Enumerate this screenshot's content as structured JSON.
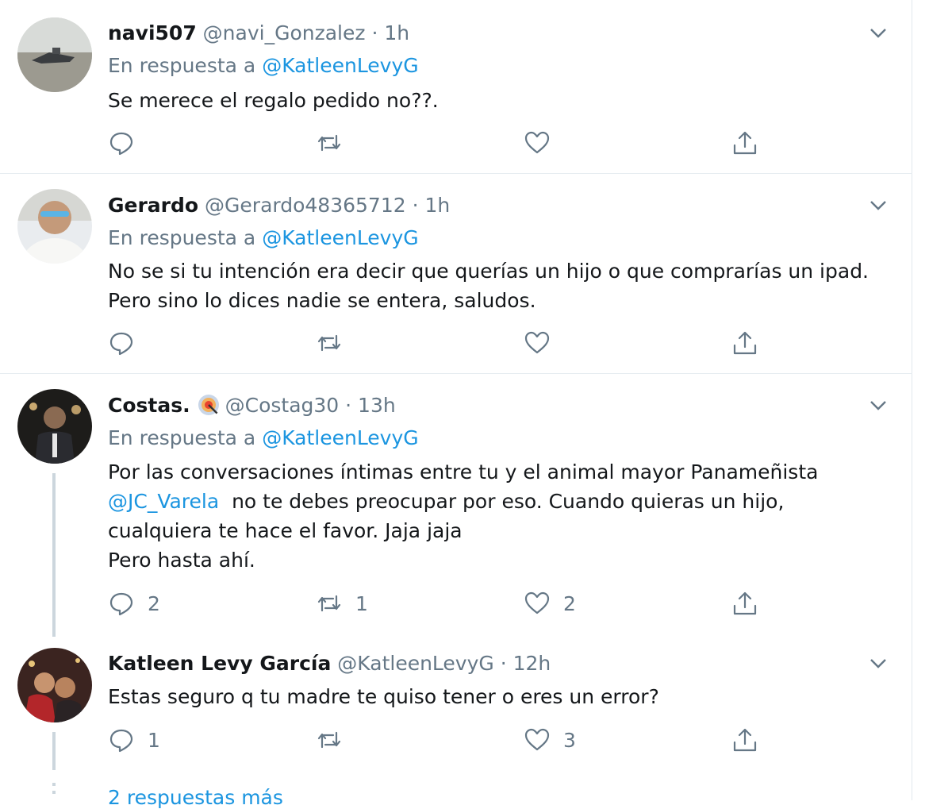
{
  "tweets": [
    {
      "name": "navi507",
      "handle": "@navi_Gonzalez",
      "time": "· 1h",
      "reply_prefix": "En respuesta a",
      "reply_to": "@KatleenLevyG",
      "body": "Se merece el regalo pedido no??.",
      "counts": {
        "reply": "",
        "retweet": "",
        "like": ""
      }
    },
    {
      "name": "Gerardo",
      "handle": "@Gerardo48365712",
      "time": "· 1h",
      "reply_prefix": "En respuesta a",
      "reply_to": "@KatleenLevyG",
      "body_lines": [
        "No se si tu intención era decir que querías un hijo o que comprarías un ipad.",
        "Pero sino lo dices nadie se entera, saludos."
      ],
      "counts": {
        "reply": "",
        "retweet": "",
        "like": ""
      }
    },
    {
      "name": "Costas.",
      "handle": "@Costag30",
      "time": "· 13h",
      "reply_prefix": "En respuesta a",
      "reply_to": "@KatleenLevyG",
      "body_line1": "Por las conversaciones íntimas entre tu y el animal mayor Panameñista",
      "mention": "@JC_Varela",
      "body_line2_rest": "  no te debes preocupar por eso. Cuando quieras un hijo,",
      "body_line3": "cualquiera te hace el favor. Jaja jaja",
      "body_line4": "Pero hasta ahí.",
      "counts": {
        "reply": "2",
        "retweet": "1",
        "like": "2"
      }
    },
    {
      "name": "Katleen Levy García",
      "handle": "@KatleenLevyG",
      "time": "· 12h",
      "body": "Estas seguro q tu madre te quiso tener o eres un error?",
      "counts": {
        "reply": "1",
        "retweet": "",
        "like": "3"
      }
    }
  ],
  "more_replies": "2 respuestas más",
  "colors": {
    "link": "#1b95e0",
    "meta": "#657786",
    "divider": "#e6ecf0"
  },
  "icons": [
    "reply-icon",
    "retweet-icon",
    "like-icon",
    "share-icon",
    "chevron-down-icon"
  ]
}
